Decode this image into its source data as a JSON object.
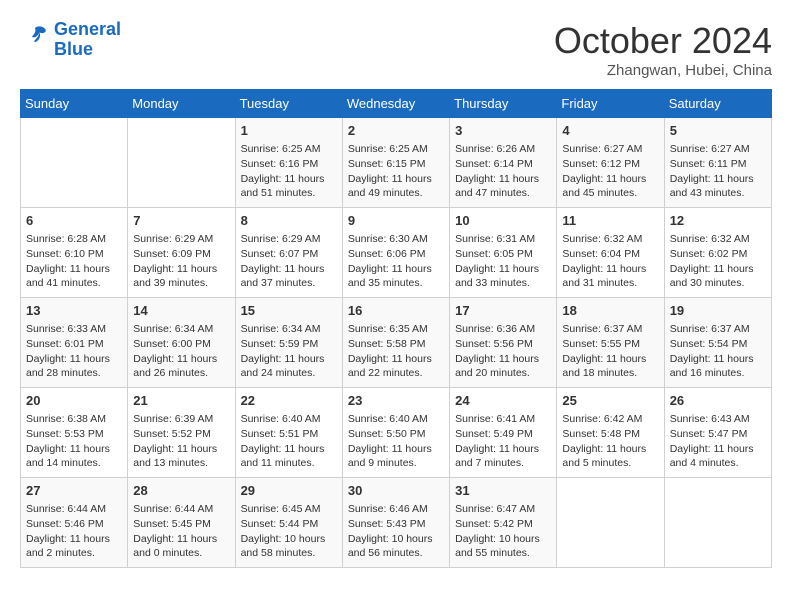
{
  "header": {
    "logo_line1": "General",
    "logo_line2": "Blue",
    "month": "October 2024",
    "location": "Zhangwan, Hubei, China"
  },
  "weekdays": [
    "Sunday",
    "Monday",
    "Tuesday",
    "Wednesday",
    "Thursday",
    "Friday",
    "Saturday"
  ],
  "weeks": [
    [
      {
        "day": "",
        "info": ""
      },
      {
        "day": "",
        "info": ""
      },
      {
        "day": "1",
        "info": "Sunrise: 6:25 AM\nSunset: 6:16 PM\nDaylight: 11 hours and 51 minutes."
      },
      {
        "day": "2",
        "info": "Sunrise: 6:25 AM\nSunset: 6:15 PM\nDaylight: 11 hours and 49 minutes."
      },
      {
        "day": "3",
        "info": "Sunrise: 6:26 AM\nSunset: 6:14 PM\nDaylight: 11 hours and 47 minutes."
      },
      {
        "day": "4",
        "info": "Sunrise: 6:27 AM\nSunset: 6:12 PM\nDaylight: 11 hours and 45 minutes."
      },
      {
        "day": "5",
        "info": "Sunrise: 6:27 AM\nSunset: 6:11 PM\nDaylight: 11 hours and 43 minutes."
      }
    ],
    [
      {
        "day": "6",
        "info": "Sunrise: 6:28 AM\nSunset: 6:10 PM\nDaylight: 11 hours and 41 minutes."
      },
      {
        "day": "7",
        "info": "Sunrise: 6:29 AM\nSunset: 6:09 PM\nDaylight: 11 hours and 39 minutes."
      },
      {
        "day": "8",
        "info": "Sunrise: 6:29 AM\nSunset: 6:07 PM\nDaylight: 11 hours and 37 minutes."
      },
      {
        "day": "9",
        "info": "Sunrise: 6:30 AM\nSunset: 6:06 PM\nDaylight: 11 hours and 35 minutes."
      },
      {
        "day": "10",
        "info": "Sunrise: 6:31 AM\nSunset: 6:05 PM\nDaylight: 11 hours and 33 minutes."
      },
      {
        "day": "11",
        "info": "Sunrise: 6:32 AM\nSunset: 6:04 PM\nDaylight: 11 hours and 31 minutes."
      },
      {
        "day": "12",
        "info": "Sunrise: 6:32 AM\nSunset: 6:02 PM\nDaylight: 11 hours and 30 minutes."
      }
    ],
    [
      {
        "day": "13",
        "info": "Sunrise: 6:33 AM\nSunset: 6:01 PM\nDaylight: 11 hours and 28 minutes."
      },
      {
        "day": "14",
        "info": "Sunrise: 6:34 AM\nSunset: 6:00 PM\nDaylight: 11 hours and 26 minutes."
      },
      {
        "day": "15",
        "info": "Sunrise: 6:34 AM\nSunset: 5:59 PM\nDaylight: 11 hours and 24 minutes."
      },
      {
        "day": "16",
        "info": "Sunrise: 6:35 AM\nSunset: 5:58 PM\nDaylight: 11 hours and 22 minutes."
      },
      {
        "day": "17",
        "info": "Sunrise: 6:36 AM\nSunset: 5:56 PM\nDaylight: 11 hours and 20 minutes."
      },
      {
        "day": "18",
        "info": "Sunrise: 6:37 AM\nSunset: 5:55 PM\nDaylight: 11 hours and 18 minutes."
      },
      {
        "day": "19",
        "info": "Sunrise: 6:37 AM\nSunset: 5:54 PM\nDaylight: 11 hours and 16 minutes."
      }
    ],
    [
      {
        "day": "20",
        "info": "Sunrise: 6:38 AM\nSunset: 5:53 PM\nDaylight: 11 hours and 14 minutes."
      },
      {
        "day": "21",
        "info": "Sunrise: 6:39 AM\nSunset: 5:52 PM\nDaylight: 11 hours and 13 minutes."
      },
      {
        "day": "22",
        "info": "Sunrise: 6:40 AM\nSunset: 5:51 PM\nDaylight: 11 hours and 11 minutes."
      },
      {
        "day": "23",
        "info": "Sunrise: 6:40 AM\nSunset: 5:50 PM\nDaylight: 11 hours and 9 minutes."
      },
      {
        "day": "24",
        "info": "Sunrise: 6:41 AM\nSunset: 5:49 PM\nDaylight: 11 hours and 7 minutes."
      },
      {
        "day": "25",
        "info": "Sunrise: 6:42 AM\nSunset: 5:48 PM\nDaylight: 11 hours and 5 minutes."
      },
      {
        "day": "26",
        "info": "Sunrise: 6:43 AM\nSunset: 5:47 PM\nDaylight: 11 hours and 4 minutes."
      }
    ],
    [
      {
        "day": "27",
        "info": "Sunrise: 6:44 AM\nSunset: 5:46 PM\nDaylight: 11 hours and 2 minutes."
      },
      {
        "day": "28",
        "info": "Sunrise: 6:44 AM\nSunset: 5:45 PM\nDaylight: 11 hours and 0 minutes."
      },
      {
        "day": "29",
        "info": "Sunrise: 6:45 AM\nSunset: 5:44 PM\nDaylight: 10 hours and 58 minutes."
      },
      {
        "day": "30",
        "info": "Sunrise: 6:46 AM\nSunset: 5:43 PM\nDaylight: 10 hours and 56 minutes."
      },
      {
        "day": "31",
        "info": "Sunrise: 6:47 AM\nSunset: 5:42 PM\nDaylight: 10 hours and 55 minutes."
      },
      {
        "day": "",
        "info": ""
      },
      {
        "day": "",
        "info": ""
      }
    ]
  ]
}
